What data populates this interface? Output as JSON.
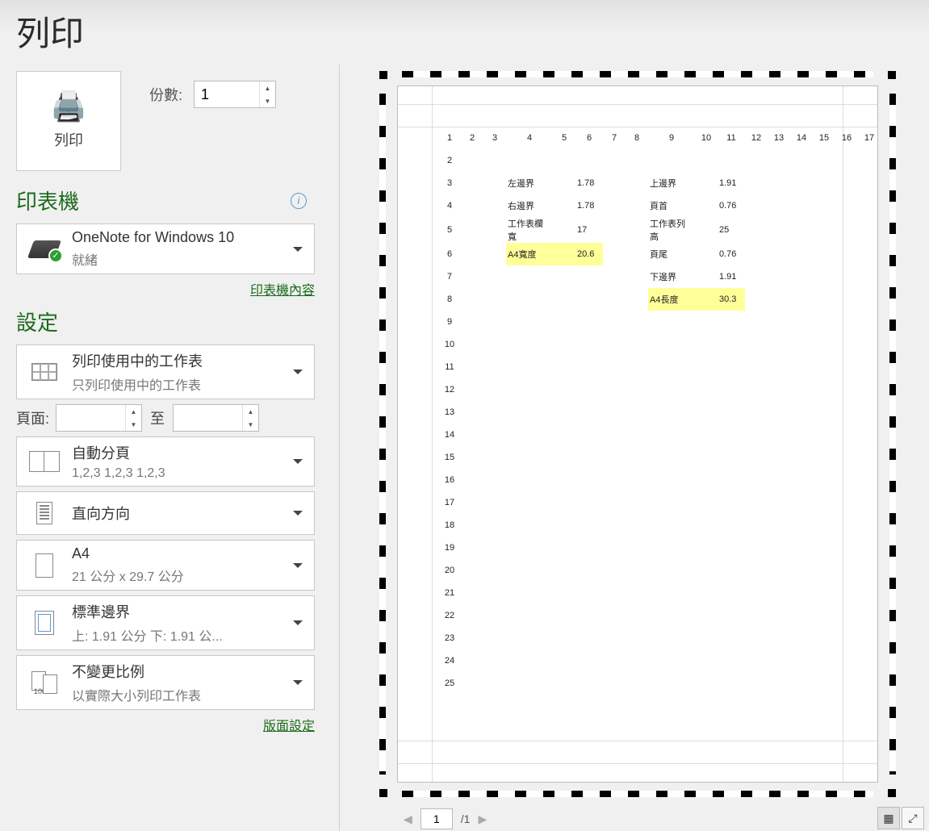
{
  "title": "列印",
  "copies": {
    "label": "份數:",
    "value": "1"
  },
  "print_button": {
    "label": "列印"
  },
  "printer": {
    "section": "印表機",
    "name": "OneNote for Windows 10",
    "status": "就緒",
    "properties_link": "印表機內容"
  },
  "settings": {
    "section": "設定",
    "what": {
      "title": "列印使用中的工作表",
      "sub": "只列印使用中的工作表"
    },
    "range": {
      "label": "頁面:",
      "from": "",
      "to_label": "至",
      "to": ""
    },
    "collate": {
      "title": "自動分頁",
      "sub": "1,2,3    1,2,3    1,2,3"
    },
    "orientation": {
      "title": "直向方向"
    },
    "paper": {
      "title": "A4",
      "sub": "21 公分 x 29.7 公分"
    },
    "margins": {
      "title": "標準邊界",
      "sub": "上: 1.91 公分 下: 1.91 公..."
    },
    "scaling": {
      "title": "不變更比例",
      "sub": "以實際大小列印工作表",
      "badge": "100"
    },
    "page_setup_link": "版面設定"
  },
  "preview": {
    "colHeaders": [
      "1",
      "2",
      "3",
      "4",
      "5",
      "6",
      "7",
      "8",
      "9",
      "10",
      "11",
      "12",
      "13",
      "14",
      "15",
      "16",
      "17"
    ],
    "rows": [
      {
        "n": "2"
      },
      {
        "n": "3",
        "c4": "左邊界",
        "c6": "1.78",
        "c9": "上邊界",
        "c11": "1.91"
      },
      {
        "n": "4",
        "c4": "右邊界",
        "c6": "1.78",
        "c9": "頁首",
        "c11": "0.76"
      },
      {
        "n": "5",
        "c4": "工作表欄寬",
        "c6": "17",
        "c9": "工作表列高",
        "c11": "25"
      },
      {
        "n": "6",
        "c4": "A4寬度",
        "c6": "20.6",
        "hlL": true,
        "c9": "頁尾",
        "c11": "0.76"
      },
      {
        "n": "7",
        "c9": "下邊界",
        "c11": "1.91"
      },
      {
        "n": "8",
        "c9": "A4長度",
        "c11": "30.3",
        "hlR": true
      },
      {
        "n": "9"
      },
      {
        "n": "10"
      },
      {
        "n": "11"
      },
      {
        "n": "12"
      },
      {
        "n": "13"
      },
      {
        "n": "14"
      },
      {
        "n": "15"
      },
      {
        "n": "16"
      },
      {
        "n": "17"
      },
      {
        "n": "18"
      },
      {
        "n": "19"
      },
      {
        "n": "20"
      },
      {
        "n": "21"
      },
      {
        "n": "22"
      },
      {
        "n": "23"
      },
      {
        "n": "24"
      },
      {
        "n": "25"
      }
    ]
  },
  "pager": {
    "current": "1",
    "total": "/1"
  }
}
